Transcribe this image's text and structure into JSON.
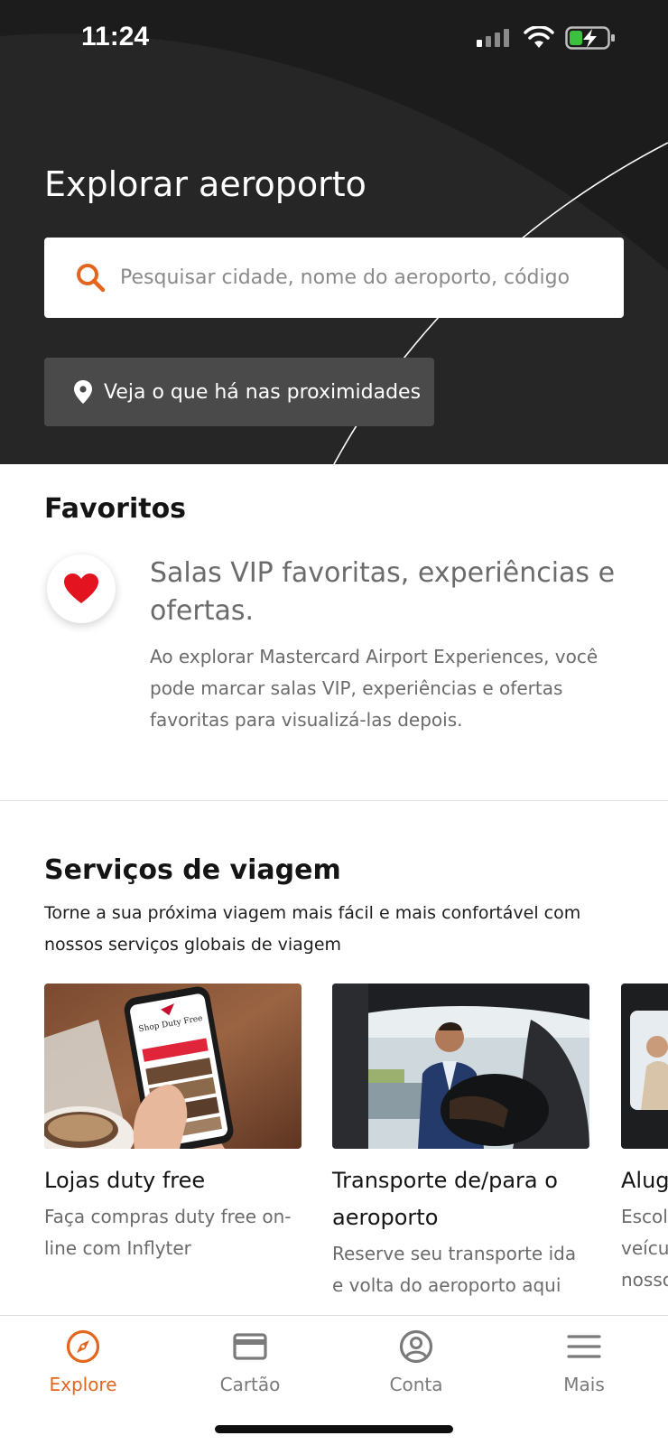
{
  "status_bar": {
    "time": "11:24"
  },
  "hero": {
    "title": "Explorar aeroporto",
    "search_placeholder": "Pesquisar cidade, nome do aeroporto, código",
    "nearby_label": "Veja o que há nas proximidades"
  },
  "favorites": {
    "title": "Favoritos",
    "heading": "Salas VIP favoritas, experiências e ofertas.",
    "body": "Ao explorar Mastercard Airport Experiences, você pode marcar salas VIP, experiências e ofertas favoritas para visualizá-las depois."
  },
  "services": {
    "title": "Serviços de viagem",
    "subtitle": "Torne a sua próxima viagem mais fácil e mais confortável com nossos serviços globais de viagem",
    "cards": [
      {
        "title": "Lojas duty free",
        "desc": "Faça compras duty free on-line com Inflyter",
        "phone_text": "Shop Duty Free"
      },
      {
        "title": "Transporte de/para o aeroporto",
        "desc": "Reserve seu transporte ida e volta do aeroporto aqui"
      },
      {
        "title": "Alug",
        "desc": "Escol veícu nosso"
      }
    ]
  },
  "tabs": [
    {
      "label": "Explore",
      "icon": "compass-icon",
      "active": true
    },
    {
      "label": "Cartão",
      "icon": "card-icon",
      "active": false
    },
    {
      "label": "Conta",
      "icon": "account-icon",
      "active": false
    },
    {
      "label": "Mais",
      "icon": "menu-icon",
      "active": false
    }
  ],
  "colors": {
    "accent": "#e2661e",
    "hero_bg": "#262626",
    "heart": "#e3141f"
  }
}
